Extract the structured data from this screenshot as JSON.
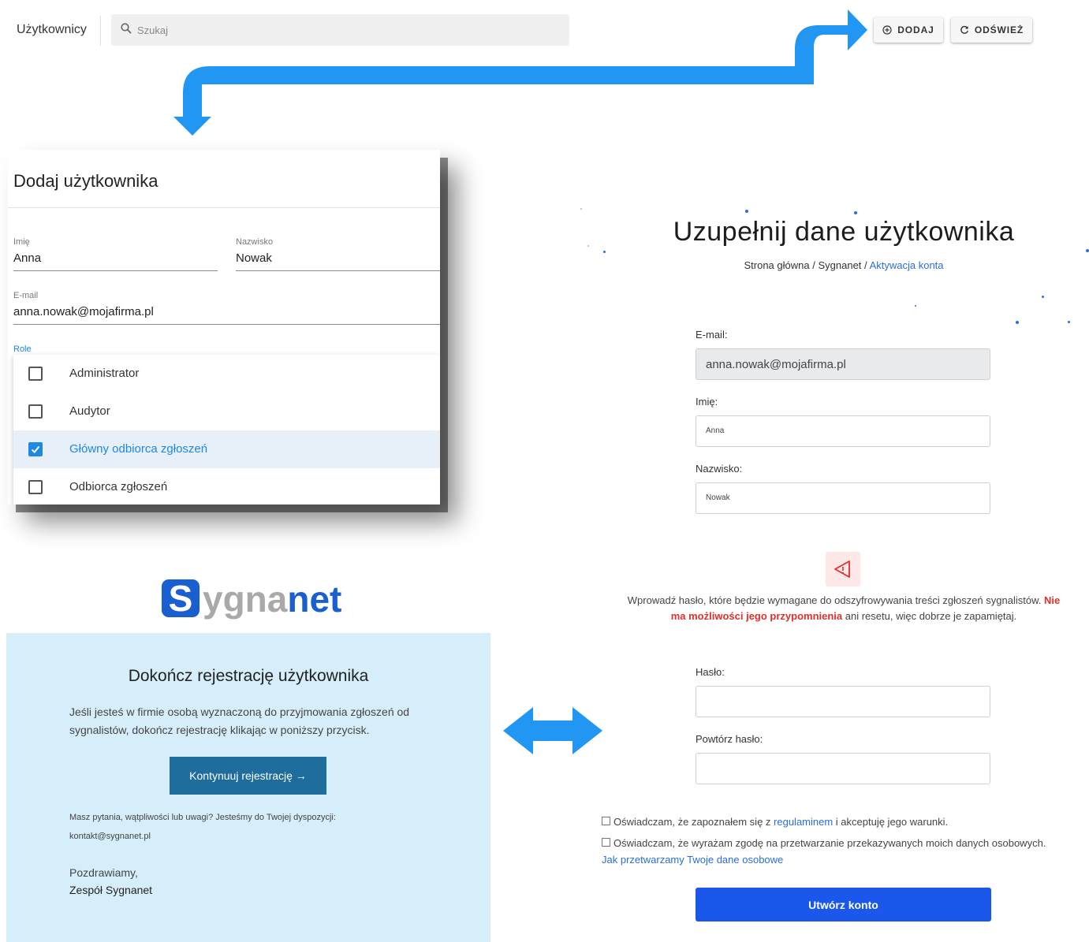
{
  "topbar": {
    "title": "Użytkownicy",
    "search_placeholder": "Szukaj",
    "add_label": "DODAJ",
    "refresh_label": "ODŚWIEŻ"
  },
  "dialog": {
    "title": "Dodaj użytkownika",
    "first_name_label": "Imię",
    "first_name_value": "Anna",
    "last_name_label": "Nazwisko",
    "last_name_value": "Nowak",
    "email_label": "E-mail",
    "email_value": "anna.nowak@mojafirma.pl",
    "roles_label": "Role",
    "roles": [
      {
        "label": "Administrator",
        "checked": false
      },
      {
        "label": "Audytor",
        "checked": false
      },
      {
        "label": "Główny odbiorca zgłoszeń",
        "checked": true
      },
      {
        "label": "Odbiorca zgłoszeń",
        "checked": false
      }
    ]
  },
  "logo": {
    "badge": "S",
    "gray": "ygna",
    "blue": "net"
  },
  "email_message": {
    "title": "Dokończ rejestrację użytkownika",
    "body": "Jeśli jesteś w firmie osobą wyznaczoną do przyjmowania zgłoszeń od sygnalistów, dokończ rejestrację klikając w poniższy przycisk.",
    "button_label": "Kontynuuj rejestrację →",
    "questions": "Masz pytania, wątpliwości lub uwagi? Jesteśmy do Twojej dyspozycji:",
    "contact": "kontakt@sygnanet.pl",
    "greeting": "Pozdrawiamy,",
    "team": "Zespół Sygnanet"
  },
  "registration": {
    "title": "Uzupełnij dane użytkownika",
    "breadcrumb": [
      "Strona główna",
      "Sygnanet",
      "Aktywacja konta"
    ],
    "breadcrumb_sep": "/",
    "email_label": "E-mail:",
    "email_value": "anna.nowak@mojafirma.pl",
    "first_name_label": "Imię:",
    "first_name_value": "Anna",
    "last_name_label": "Nazwisko:",
    "last_name_value": "Nowak",
    "warning_pre": "Wprowadź hasło, które będzie wymagane do odszyfrowywania treści zgłoszeń sygnalistów. ",
    "warning_bold": "Nie ma możliwości jego przypomnienia",
    "warning_post": " ani resetu, więc dobrze je zapamiętaj.",
    "password_label": "Hasło:",
    "password_repeat_label": "Powtórz hasło:",
    "terms_pre": "Oświadczam, że zapoznałem się z ",
    "terms_link": "regulaminem",
    "terms_post": " i akceptuję jego warunki.",
    "consent_text": "Oświadczam, że wyrażam zgodę na przetwarzanie przekazywanych moich danych osobowych. ",
    "consent_link": "Jak przetwarzamy Twoje dane osobowe",
    "submit_label": "Utwórz konto"
  },
  "colors": {
    "arrow": "#2196f3",
    "brand_blue": "#1a5fcf",
    "email_bg": "#d6eefa",
    "submit": "#1a57ea",
    "warning_red": "#e0302a"
  }
}
